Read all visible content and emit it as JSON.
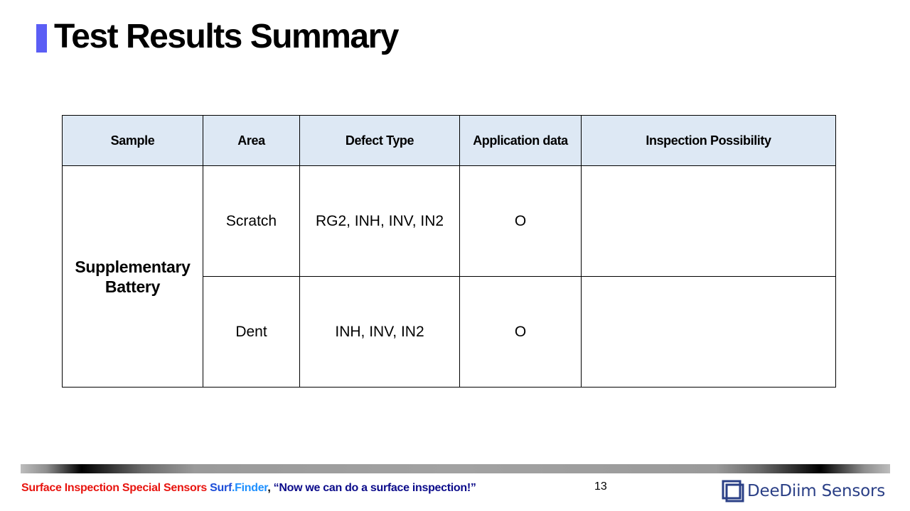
{
  "title": "Test Results Summary",
  "table": {
    "headers": [
      "Sample",
      "Area",
      "Defect Type",
      "Application data",
      "Inspection Possibility"
    ],
    "sample": "Supplementary Battery",
    "rows": [
      {
        "area": "Scratch",
        "defect_type": "RG2, INH, INV, IN2",
        "application_data": "O",
        "inspection_possibility": ""
      },
      {
        "area": "Dent",
        "defect_type": "INH, INV, IN2",
        "application_data": "O",
        "inspection_possibility": ""
      }
    ]
  },
  "footer": {
    "part1": "Surface Inspection Special Sensors ",
    "part2": "Surf",
    "part3": ".Finder",
    "part4": ", ",
    "part5": "“Now we can do a surface inspection!”",
    "page_number": "13",
    "logo_text": "DeeDiim Sensors"
  },
  "colors": {
    "title_accent": "#5b5ef5",
    "header_fill": "#dde8f4",
    "footer_red": "#e8140f",
    "footer_navy": "#0b0b8a",
    "logo": "#2a3f86"
  }
}
